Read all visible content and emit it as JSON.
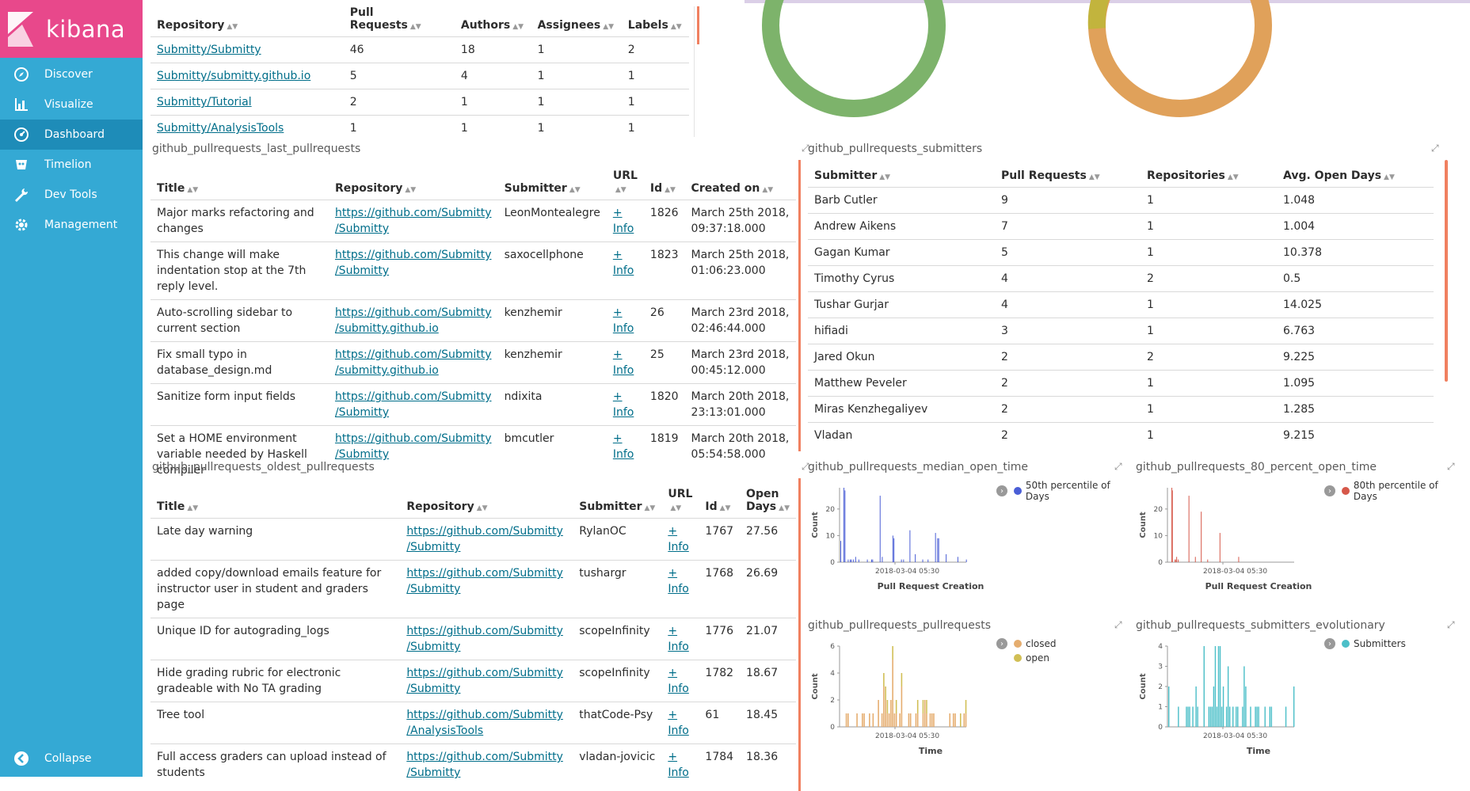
{
  "app": {
    "brand": "kibana"
  },
  "sidebar": {
    "items": [
      {
        "label": "Discover",
        "icon": "compass-icon"
      },
      {
        "label": "Visualize",
        "icon": "bar-chart-icon"
      },
      {
        "label": "Dashboard",
        "icon": "dashboard-icon",
        "active": true
      },
      {
        "label": "Timelion",
        "icon": "timelion-icon"
      },
      {
        "label": "Dev Tools",
        "icon": "wrench-icon"
      },
      {
        "label": "Management",
        "icon": "gear-icon"
      }
    ],
    "collapse_label": "Collapse"
  },
  "repos_table": {
    "headers": [
      "Repository",
      "Pull Requests",
      "Authors",
      "Assignees",
      "Labels"
    ],
    "rows": [
      [
        "Submitty/Submitty",
        "46",
        "18",
        "1",
        "2"
      ],
      [
        "Submitty/submitty.github.io",
        "5",
        "4",
        "1",
        "1"
      ],
      [
        "Submitty/Tutorial",
        "2",
        "1",
        "1",
        "1"
      ],
      [
        "Submitty/AnalysisTools",
        "1",
        "1",
        "1",
        "1"
      ]
    ]
  },
  "last_prs": {
    "title": "github_pullrequests_last_pullrequests",
    "headers": [
      "Title",
      "Repository",
      "Submitter",
      "URL",
      "Id",
      "Created on"
    ],
    "rows": [
      {
        "title": "Major marks refactoring and changes",
        "repo1": "https://github.com/Submitty",
        "repo2": "/Submitty",
        "submitter": "LeonMontealegre",
        "url1": "+",
        "url2": "Info",
        "id": "1826",
        "date1": "March 25th 2018,",
        "date2": "09:37:18.000"
      },
      {
        "title": "This change will make indentation stop at the 7th reply level.",
        "repo1": "https://github.com/Submitty",
        "repo2": "/Submitty",
        "submitter": "saxocellphone",
        "url1": "+",
        "url2": "Info",
        "id": "1823",
        "date1": "March 25th 2018,",
        "date2": "01:06:23.000"
      },
      {
        "title": "Auto-scrolling sidebar to current section",
        "repo1": "https://github.com/Submitty",
        "repo2": "/submitty.github.io",
        "submitter": "kenzhemir",
        "url1": "+",
        "url2": "Info",
        "id": "26",
        "date1": "March 23rd 2018,",
        "date2": "02:46:44.000"
      },
      {
        "title": "Fix small typo in database_design.md",
        "repo1": "https://github.com/Submitty",
        "repo2": "/submitty.github.io",
        "submitter": "kenzhemir",
        "url1": "+",
        "url2": "Info",
        "id": "25",
        "date1": "March 23rd 2018,",
        "date2": "00:45:12.000"
      },
      {
        "title": "Sanitize form input fields",
        "repo1": "https://github.com/Submitty",
        "repo2": "/Submitty",
        "submitter": "ndixita",
        "url1": "+",
        "url2": "Info",
        "id": "1820",
        "date1": "March 20th 2018,",
        "date2": "23:13:01.000"
      },
      {
        "title": "Set a HOME environment variable needed by Haskell compiler",
        "repo1": "https://github.com/Submitty",
        "repo2": "/Submitty",
        "submitter": "bmcutler",
        "url1": "+",
        "url2": "Info",
        "id": "1819",
        "date1": "March 20th 2018,",
        "date2": "05:54:58.000"
      }
    ]
  },
  "oldest_prs": {
    "title": "github_pullrequests_oldest_pullrequests",
    "headers": [
      "Title",
      "Repository",
      "Submitter",
      "URL",
      "Id",
      "Open Days"
    ],
    "rows": [
      {
        "title": "Late day warning",
        "repo1": "https://github.com/Submitty",
        "repo2": "/Submitty",
        "submitter": "RylanOC",
        "url1": "+",
        "url2": "Info",
        "id": "1767",
        "days": "27.56"
      },
      {
        "title": "added copy/download emails feature for instructor user in student and graders page",
        "repo1": "https://github.com/Submitty",
        "repo2": "/Submitty",
        "submitter": "tushargr",
        "url1": "+",
        "url2": "Info",
        "id": "1768",
        "days": "26.69"
      },
      {
        "title": "Unique ID for autograding_logs",
        "repo1": "https://github.com/Submitty",
        "repo2": "/Submitty",
        "submitter": "scopeInfinity",
        "url1": "+",
        "url2": "Info",
        "id": "1776",
        "days": "21.07"
      },
      {
        "title": "Hide grading rubric for electronic gradeable with No TA grading",
        "repo1": "https://github.com/Submitty",
        "repo2": "/Submitty",
        "submitter": "scopeInfinity",
        "url1": "+",
        "url2": "Info",
        "id": "1782",
        "days": "18.67"
      },
      {
        "title": "Tree tool",
        "repo1": "https://github.com/Submitty",
        "repo2": "/AnalysisTools",
        "submitter": "thatCode-Psy",
        "url1": "+",
        "url2": "Info",
        "id": "61",
        "days": "18.45"
      },
      {
        "title": "Full access graders can upload instead of students",
        "repo1": "https://github.com/Submitty",
        "repo2": "/Submitty",
        "submitter": "vladan-jovicic",
        "url1": "+",
        "url2": "Info",
        "id": "1784",
        "days": "18.36"
      }
    ]
  },
  "submitters": {
    "title": "github_pullrequests_submitters",
    "headers": [
      "Submitter",
      "Pull Requests",
      "Repositories",
      "Avg. Open Days"
    ],
    "rows": [
      [
        "Barb Cutler",
        "9",
        "1",
        "1.048"
      ],
      [
        "Andrew Aikens",
        "7",
        "1",
        "1.004"
      ],
      [
        "Gagan Kumar",
        "5",
        "1",
        "10.378"
      ],
      [
        "Timothy Cyrus",
        "4",
        "2",
        "0.5"
      ],
      [
        "Tushar Gurjar",
        "4",
        "1",
        "14.025"
      ],
      [
        "hifiadi",
        "3",
        "1",
        "6.763"
      ],
      [
        "Jared Okun",
        "2",
        "2",
        "9.225"
      ],
      [
        "Matthew Peveler",
        "2",
        "1",
        "1.095"
      ],
      [
        "Miras Kenzhegaliyev",
        "2",
        "1",
        "1.285"
      ],
      [
        "Vladan",
        "2",
        "1",
        "9.215"
      ]
    ]
  },
  "colors": {
    "donut_green": "#7db36b",
    "donut_orange": "#e0a15a",
    "donut_olive": "#c2b43d",
    "blue_bar": "#4a5ed6",
    "red_bar": "#d6584a",
    "closed": "#e5ad6f",
    "open": "#d1bf55",
    "teal": "#4bbfc8"
  },
  "chart_data": [
    {
      "type": "bar",
      "title": "github_pullrequests_median_open_time",
      "legend": [
        "50th percentile of Days"
      ],
      "xlabel": "Pull Request Creation",
      "ylabel": "Count",
      "x_tick": "2018-03-04 05:30",
      "yticks": [
        "0",
        "10",
        "20"
      ],
      "ylim": [
        0,
        28
      ],
      "values": [
        8,
        0,
        0,
        28,
        27,
        0,
        0,
        1,
        0,
        1,
        1,
        0,
        1,
        0,
        2,
        0,
        0,
        1,
        0,
        0,
        0,
        0,
        0,
        0,
        0,
        1,
        0,
        0,
        0,
        1,
        1,
        0,
        0,
        0,
        0,
        0,
        0,
        25,
        0,
        2,
        0,
        0,
        0,
        0,
        0,
        0,
        0,
        0,
        0,
        10,
        9,
        0,
        0,
        0,
        0,
        0,
        0,
        1,
        0,
        1,
        0,
        0,
        0,
        0,
        0,
        12,
        0,
        0,
        0,
        0,
        3,
        0,
        0,
        0,
        0,
        0,
        0,
        1,
        0,
        0,
        0,
        0,
        1,
        0,
        0,
        0,
        0,
        0,
        0,
        11,
        0,
        9,
        9,
        0,
        0,
        0,
        0,
        0,
        0,
        3,
        0,
        0,
        0,
        0,
        0,
        0,
        0,
        0,
        0,
        0,
        2,
        0,
        0,
        0,
        0,
        0,
        0,
        0,
        1
      ]
    },
    {
      "type": "bar",
      "title": "github_pullrequests_80_percent_open_time",
      "legend": [
        "80th percentile of Days"
      ],
      "xlabel": "Pull Request Creation",
      "ylabel": "Count",
      "x_tick": "2018-03-04 05:30",
      "yticks": [
        "0",
        "10",
        "20"
      ],
      "ylim": [
        0,
        28
      ],
      "values": [
        0,
        0,
        0,
        0,
        0,
        0,
        28,
        27,
        0,
        0,
        0,
        0,
        1,
        0,
        1,
        2,
        0,
        0,
        1,
        0,
        0,
        0,
        0,
        0,
        0,
        0,
        0,
        0,
        0,
        0,
        0,
        0,
        0,
        0,
        0,
        0,
        0,
        0,
        25,
        0,
        0,
        0,
        0,
        0,
        0,
        0,
        0,
        0,
        0,
        0,
        2,
        0,
        0,
        0,
        0,
        0,
        0,
        0,
        0,
        0,
        0,
        19,
        0,
        0,
        0,
        0,
        0,
        0,
        0,
        0,
        0,
        0,
        0,
        1,
        0,
        0,
        0,
        0,
        0,
        0,
        0,
        0,
        0,
        0,
        0,
        0,
        0,
        0,
        0,
        0,
        0,
        0,
        0,
        0,
        0,
        0,
        11,
        0,
        0,
        0,
        0,
        0,
        0,
        0,
        0,
        0,
        0,
        0,
        0,
        0,
        0,
        0,
        0,
        0,
        0,
        0,
        0,
        0,
        0,
        0,
        0,
        0,
        0,
        0,
        0,
        0,
        0,
        0,
        0,
        0,
        0,
        2,
        0,
        0,
        0,
        0,
        0,
        0,
        0,
        0,
        0,
        0,
        0,
        0,
        0,
        0,
        0,
        0,
        0,
        0,
        0,
        0,
        0,
        0,
        0,
        0,
        0,
        0,
        0,
        0,
        0,
        0,
        0,
        0,
        0,
        0,
        0,
        0,
        0,
        0,
        0,
        0,
        0,
        0,
        0,
        0,
        0,
        0,
        0,
        0,
        0,
        0,
        0,
        0,
        0,
        0,
        0,
        0,
        0,
        0,
        0,
        0,
        0,
        0,
        0,
        0,
        0,
        0,
        0,
        0,
        0,
        0,
        0,
        0,
        0,
        0,
        0,
        0,
        0,
        0,
        0,
        0,
        0,
        0,
        0,
        0,
        0,
        0,
        0,
        0,
        0,
        0,
        0,
        0,
        0,
        0,
        0,
        0,
        0,
        0,
        0,
        0,
        0,
        0,
        0,
        0,
        0
      ]
    },
    {
      "type": "bar",
      "title": "github_pullrequests_pullrequests",
      "legend": [
        "closed",
        "open"
      ],
      "xlabel": "Time",
      "ylabel": "Count",
      "x_tick": "2018-03-04 05:30",
      "yticks": [
        "0",
        "2",
        "4",
        "6"
      ],
      "ylim": [
        0,
        6
      ],
      "series": [
        {
          "name": "closed",
          "values": [
            0,
            0,
            0,
            1,
            1,
            0,
            0,
            0,
            0,
            1,
            0,
            0,
            1,
            1,
            0,
            0,
            1,
            0,
            1,
            0,
            0,
            2,
            0,
            1,
            3,
            2,
            1,
            1,
            2,
            5,
            1,
            1,
            0,
            1,
            3,
            0,
            0,
            0,
            1,
            1,
            0,
            0,
            1,
            1,
            0,
            0,
            1,
            2,
            1,
            0,
            1,
            1,
            1,
            0,
            0,
            0,
            0,
            0,
            0,
            0,
            0,
            1,
            0,
            1,
            1,
            0,
            0,
            0,
            0,
            1,
            1
          ]
        },
        {
          "name": "open",
          "values": [
            0,
            0,
            0,
            0,
            0,
            0,
            0,
            0,
            0,
            0,
            0,
            0,
            0,
            0,
            0,
            0,
            0,
            0,
            0,
            0,
            0,
            0,
            0,
            0,
            1,
            1,
            1,
            0,
            0,
            1,
            0,
            1,
            0,
            0,
            1,
            0,
            0,
            0,
            0,
            0,
            0,
            0,
            0,
            1,
            0,
            0,
            1,
            0,
            1,
            0,
            0,
            0,
            0,
            0,
            0,
            0,
            0,
            0,
            0,
            0,
            0,
            0,
            0,
            0,
            0,
            0,
            0,
            1,
            0,
            0,
            1
          ]
        }
      ]
    },
    {
      "type": "bar",
      "title": "github_pullrequests_submitters_evolutionary",
      "legend": [
        "Submitters"
      ],
      "xlabel": "Time",
      "ylabel": "Count",
      "x_tick": "2018-03-04 05:30",
      "yticks": [
        "0",
        "1",
        "2",
        "3",
        "4"
      ],
      "ylim": [
        0,
        4
      ],
      "values": [
        2,
        0,
        0,
        0,
        0,
        0,
        1,
        0,
        0,
        0,
        0,
        1,
        1,
        1,
        0,
        1,
        0,
        2,
        1,
        0,
        0,
        0,
        4,
        0,
        0,
        1,
        1,
        1,
        2,
        4,
        1,
        4,
        4,
        1,
        2,
        0,
        1,
        3,
        1,
        0,
        1,
        0,
        1,
        1,
        0,
        0,
        1,
        3,
        2,
        0,
        0,
        1,
        0,
        0,
        1,
        1,
        1,
        0,
        0,
        0,
        1,
        0,
        0,
        1,
        1,
        0,
        0,
        0,
        0,
        0,
        0,
        0,
        0,
        1,
        0,
        0,
        0,
        0,
        2
      ]
    }
  ]
}
